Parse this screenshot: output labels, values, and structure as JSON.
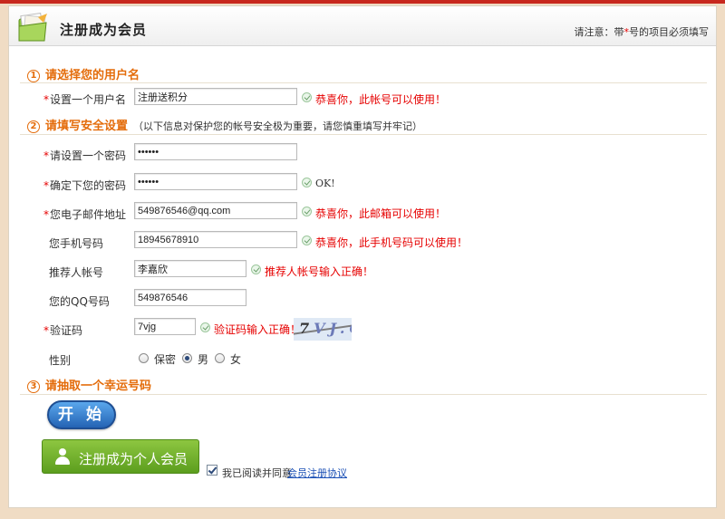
{
  "header": {
    "title": "注册成为会员",
    "note_prefix": "请注意：带",
    "note_star": "*",
    "note_suffix": "号的项目必须填写"
  },
  "sections": [
    {
      "num": "1",
      "title": "请选择您的用户名",
      "subtitle": ""
    },
    {
      "num": "2",
      "title": "请填写安全设置",
      "subtitle": "（以下信息对保护您的帐号安全极为重要，请您慎重填写并牢记）"
    },
    {
      "num": "3",
      "title": "请抽取一个幸运号码",
      "subtitle": ""
    }
  ],
  "fields": {
    "username": {
      "label": "设置一个用户名",
      "value": "注册送积分",
      "message": "恭喜你，此帐号可以使用！"
    },
    "password": {
      "label": "请设置一个密码",
      "value": "••••••"
    },
    "password_confirm": {
      "label": "确定下您的密码",
      "value": "••••••",
      "message": "OK!"
    },
    "email": {
      "label": "您电子邮件地址",
      "value": "549876546@qq.com",
      "message": "恭喜你，此邮箱可以使用！"
    },
    "phone": {
      "label": "您手机号码",
      "value": "18945678910",
      "message": "恭喜你，此手机号码可以使用！"
    },
    "referrer": {
      "label": "推荐人帐号",
      "value": "李嘉欣",
      "message": "推荐人帐号输入正确！"
    },
    "qq": {
      "label": "您的QQ号码",
      "value": "549876546"
    },
    "captcha": {
      "label": "验证码",
      "value": "7vjg",
      "message": "验证码输入正确！",
      "image_text_a": "7",
      "image_text_b": "VJ.G"
    },
    "gender": {
      "label": "性别",
      "options": [
        "保密",
        "男",
        "女"
      ],
      "selected": "男"
    }
  },
  "required_mark": "*",
  "buttons": {
    "start": "开 始",
    "register": "注册成为个人会员"
  },
  "agreement": {
    "text": "我已阅读并同意",
    "link": "会员注册协议",
    "checked": true
  },
  "colors": {
    "accent_orange": "#e46c0a",
    "error_red": "#e60000",
    "register_green": "#6fae28",
    "start_blue": "#2f76c8"
  }
}
